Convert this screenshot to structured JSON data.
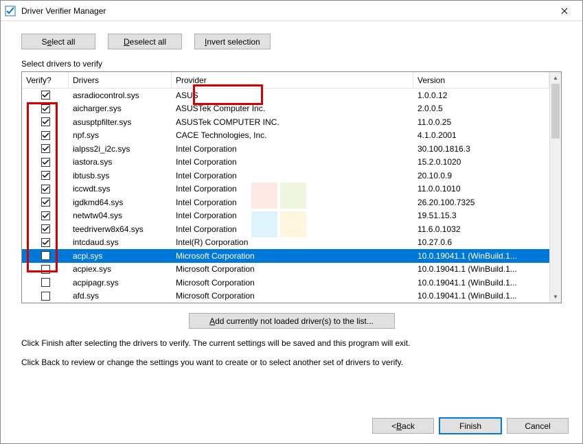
{
  "title": "Driver Verifier Manager",
  "buttons": {
    "select_all_pre": "S",
    "select_all_u": "e",
    "select_all_post": "lect all",
    "deselect_all_pre": "",
    "deselect_all_u": "D",
    "deselect_all_post": "eselect all",
    "invert_pre": "",
    "invert_u": "I",
    "invert_post": "nvert selection"
  },
  "label_select": "Select drivers to verify",
  "cols": {
    "verify": "Verify?",
    "drivers": "Drivers",
    "provider": "Provider",
    "version": "Version"
  },
  "rows": [
    {
      "chk": true,
      "driver": "asradiocontrol.sys",
      "provider": "ASUS",
      "version": "1.0.0.12",
      "sel": false
    },
    {
      "chk": true,
      "driver": "aicharger.sys",
      "provider": "ASUSTek Computer Inc.",
      "version": "2.0.0.5",
      "sel": false
    },
    {
      "chk": true,
      "driver": "asusptpfilter.sys",
      "provider": "ASUSTek COMPUTER INC.",
      "version": "11.0.0.25",
      "sel": false
    },
    {
      "chk": true,
      "driver": "npf.sys",
      "provider": "CACE Technologies, Inc.",
      "version": "4.1.0.2001",
      "sel": false
    },
    {
      "chk": true,
      "driver": "ialpss2i_i2c.sys",
      "provider": "Intel Corporation",
      "version": "30.100.1816.3",
      "sel": false
    },
    {
      "chk": true,
      "driver": "iastora.sys",
      "provider": "Intel Corporation",
      "version": "15.2.0.1020",
      "sel": false
    },
    {
      "chk": true,
      "driver": "ibtusb.sys",
      "provider": "Intel Corporation",
      "version": "20.10.0.9",
      "sel": false
    },
    {
      "chk": true,
      "driver": "iccwdt.sys",
      "provider": "Intel Corporation",
      "version": "11.0.0.1010",
      "sel": false
    },
    {
      "chk": true,
      "driver": "igdkmd64.sys",
      "provider": "Intel Corporation",
      "version": "26.20.100.7325",
      "sel": false
    },
    {
      "chk": true,
      "driver": "netwtw04.sys",
      "provider": "Intel Corporation",
      "version": "19.51.15.3",
      "sel": false
    },
    {
      "chk": true,
      "driver": "teedriverw8x64.sys",
      "provider": "Intel Corporation",
      "version": "11.6.0.1032",
      "sel": false
    },
    {
      "chk": true,
      "driver": "intcdaud.sys",
      "provider": "Intel(R) Corporation",
      "version": "10.27.0.6",
      "sel": false
    },
    {
      "chk": false,
      "driver": "acpi.sys",
      "provider": "Microsoft Corporation",
      "version": "10.0.19041.1 (WinBuild.1...",
      "sel": true
    },
    {
      "chk": false,
      "driver": "acpiex.sys",
      "provider": "Microsoft Corporation",
      "version": "10.0.19041.1 (WinBuild.1...",
      "sel": false
    },
    {
      "chk": false,
      "driver": "acpipagr.sys",
      "provider": "Microsoft Corporation",
      "version": "10.0.19041.1 (WinBuild.1...",
      "sel": false
    },
    {
      "chk": false,
      "driver": "afd.sys",
      "provider": "Microsoft Corporation",
      "version": "10.0.19041.1 (WinBuild.1...",
      "sel": false
    }
  ],
  "add_button_pre": "",
  "add_button_u": "A",
  "add_button_post": "dd currently not loaded driver(s) to the list...",
  "help1": "Click Finish after selecting the drivers to verify. The current settings will be saved and this program will exit.",
  "help2": "Click Back to review or change the settings you want to create or to select another set of drivers to verify.",
  "footer": {
    "back_pre": "< ",
    "back_u": "B",
    "back_post": "ack",
    "finish": "Finish",
    "cancel": "Cancel"
  }
}
